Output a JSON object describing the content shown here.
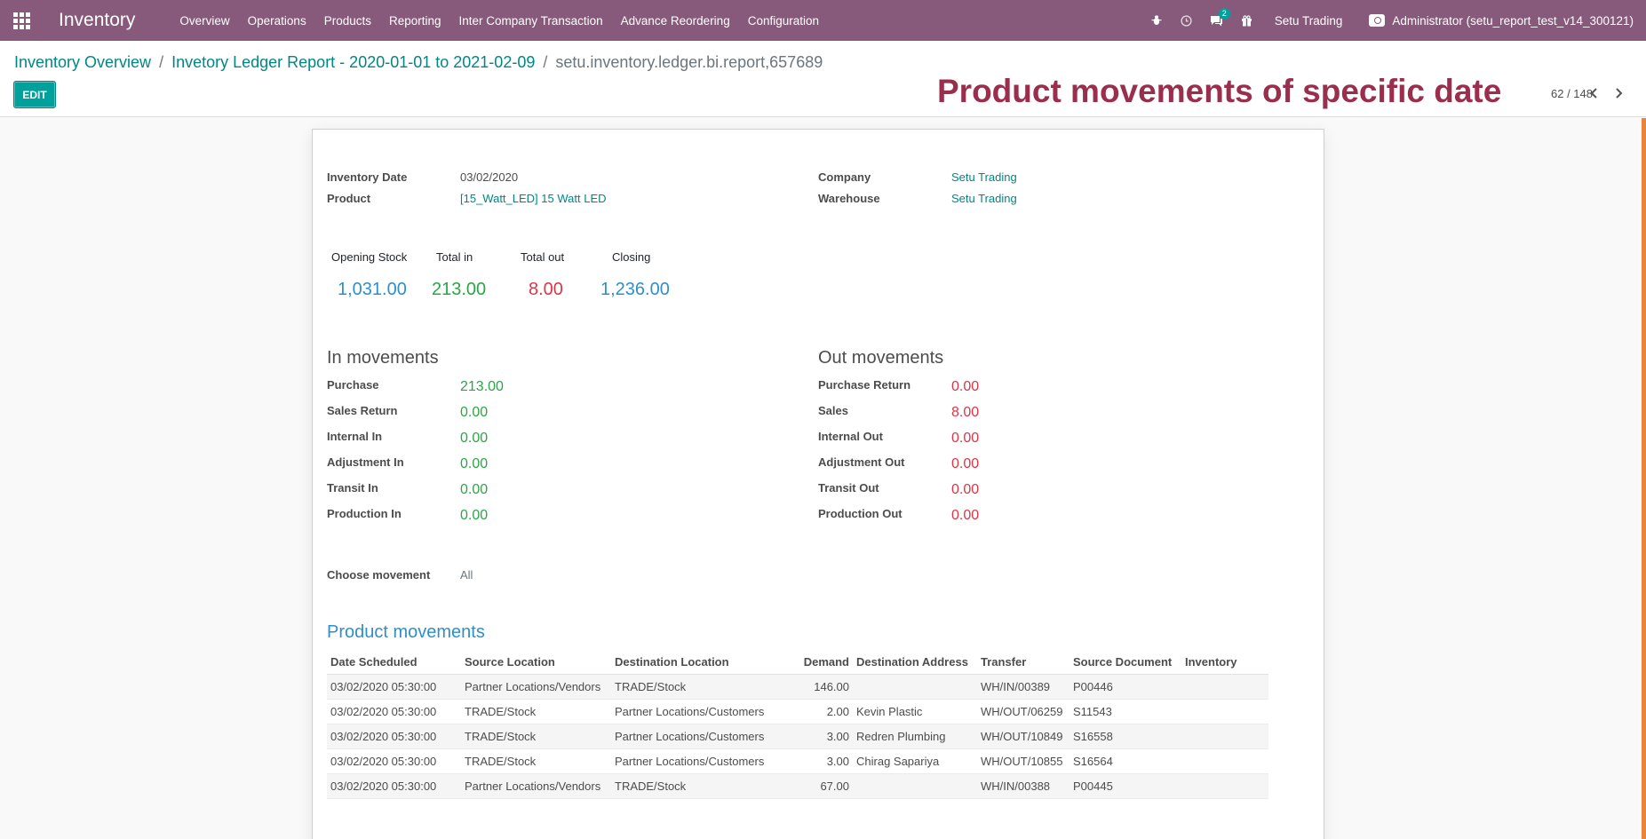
{
  "navbar": {
    "app_title": "Inventory",
    "menu": [
      "Overview",
      "Operations",
      "Products",
      "Reporting",
      "Inter Company Transaction",
      "Advance Reordering",
      "Configuration"
    ],
    "messages_count": "2",
    "company": "Setu Trading",
    "user": "Administrator (setu_report_test_v14_300121)"
  },
  "breadcrumb": {
    "root": "Inventory Overview",
    "parent": "Invetory Ledger Report - 2020-01-01 to 2021-02-09",
    "current": "setu.inventory.ledger.bi.report,657689"
  },
  "toolbar": {
    "edit_label": "EDIT",
    "pager": "62 / 148"
  },
  "annotation": "Product movements of specific date",
  "colors": {
    "brand": "#875a7b",
    "accent": "#00a09d",
    "positive": "#28a745",
    "negative": "#dc3545",
    "info": "#2f8fc9"
  },
  "form": {
    "inventory_date_label": "Inventory Date",
    "inventory_date": "03/02/2020",
    "product_label": "Product",
    "product": "[15_Watt_LED] 15 Watt LED",
    "company_label": "Company",
    "company": "Setu Trading",
    "warehouse_label": "Warehouse",
    "warehouse": "Setu Trading"
  },
  "stats": {
    "opening_label": "Opening Stock",
    "opening": "1,031.00",
    "in_label": "Total in",
    "in": "213.00",
    "out_label": "Total out",
    "out": "8.00",
    "closing_label": "Closing",
    "closing": "1,236.00"
  },
  "in_movements": {
    "title": "In movements",
    "rows": [
      {
        "label": "Purchase",
        "value": "213.00"
      },
      {
        "label": "Sales Return",
        "value": "0.00"
      },
      {
        "label": "Internal In",
        "value": "0.00"
      },
      {
        "label": "Adjustment In",
        "value": "0.00"
      },
      {
        "label": "Transit In",
        "value": "0.00"
      },
      {
        "label": "Production In",
        "value": "0.00"
      }
    ]
  },
  "out_movements": {
    "title": "Out movements",
    "rows": [
      {
        "label": "Purchase Return",
        "value": "0.00"
      },
      {
        "label": "Sales",
        "value": "8.00"
      },
      {
        "label": "Internal Out",
        "value": "0.00"
      },
      {
        "label": "Adjustment Out",
        "value": "0.00"
      },
      {
        "label": "Transit Out",
        "value": "0.00"
      },
      {
        "label": "Production Out",
        "value": "0.00"
      }
    ]
  },
  "choose_movement": {
    "label": "Choose movement",
    "value": "All"
  },
  "product_movements": {
    "title": "Product movements",
    "columns": [
      "Date Scheduled",
      "Source Location",
      "Destination Location",
      "Demand",
      "Destination Address",
      "Transfer",
      "Source Document",
      "Inventory"
    ],
    "rows": [
      [
        "03/02/2020 05:30:00",
        "Partner Locations/Vendors",
        "TRADE/Stock",
        "146.00",
        "",
        "WH/IN/00389",
        "P00446",
        ""
      ],
      [
        "03/02/2020 05:30:00",
        "TRADE/Stock",
        "Partner Locations/Customers",
        "2.00",
        "Kevin Plastic",
        "WH/OUT/06259",
        "S11543",
        ""
      ],
      [
        "03/02/2020 05:30:00",
        "TRADE/Stock",
        "Partner Locations/Customers",
        "3.00",
        "Redren Plumbing",
        "WH/OUT/10849",
        "S16558",
        ""
      ],
      [
        "03/02/2020 05:30:00",
        "TRADE/Stock",
        "Partner Locations/Customers",
        "3.00",
        "Chirag Sapariya",
        "WH/OUT/10855",
        "S16564",
        ""
      ],
      [
        "03/02/2020 05:30:00",
        "Partner Locations/Vendors",
        "TRADE/Stock",
        "67.00",
        "",
        "WH/IN/00388",
        "P00445",
        ""
      ]
    ]
  }
}
